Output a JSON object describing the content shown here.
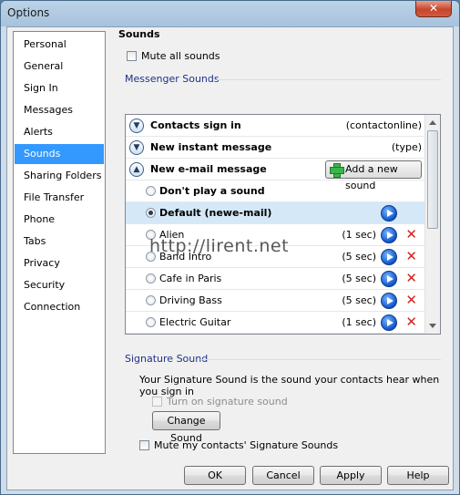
{
  "window": {
    "title": "Options",
    "close_glyph": "✕"
  },
  "nav": {
    "items": [
      "Personal",
      "General",
      "Sign In",
      "Messages",
      "Alerts",
      "Sounds",
      "Sharing Folders",
      "File Transfer",
      "Phone",
      "Tabs",
      "Privacy",
      "Security",
      "Connection"
    ],
    "selected": "Sounds"
  },
  "sounds": {
    "title": "Sounds",
    "mute_all_label": "Mute all sounds",
    "mute_all_checked": false,
    "messenger_sounds_label": "Messenger Sounds",
    "events": [
      {
        "label": "Contacts sign in",
        "value": "(contactonline)",
        "expanded": false
      },
      {
        "label": "New instant message",
        "value": "(type)",
        "expanded": false
      },
      {
        "label": "New e-mail message",
        "expanded": true,
        "action_label": "Add a new sound"
      }
    ],
    "options": [
      {
        "name": "Don't play a sound",
        "duration": "",
        "selected": false
      },
      {
        "name": "Default (newe-mail)",
        "duration": "",
        "selected": true
      },
      {
        "name": "Alien",
        "duration": "(1 sec)",
        "selected": false
      },
      {
        "name": "Band Intro",
        "duration": "(5 sec)",
        "selected": false
      },
      {
        "name": "Cafe in Paris",
        "duration": "(5 sec)",
        "selected": false
      },
      {
        "name": "Driving Bass",
        "duration": "(5 sec)",
        "selected": false
      },
      {
        "name": "Electric Guitar",
        "duration": "(1 sec)",
        "selected": false
      }
    ]
  },
  "signature": {
    "label": "Signature Sound",
    "description": "Your Signature Sound is the sound your contacts hear when you sign in",
    "turn_on_label": "Turn on signature sound",
    "turn_on_enabled": false,
    "change_button": "Change Sound",
    "mute_contacts_label": "Mute my contacts' Signature Sounds",
    "mute_contacts_checked": false
  },
  "footer": {
    "ok": "OK",
    "cancel": "Cancel",
    "apply": "Apply",
    "help": "Help"
  },
  "watermark": "http://lirent.net",
  "icons": {
    "expand": "chevron-down-icon",
    "collapse": "chevron-up-icon",
    "play": "play-icon",
    "delete": "delete-x-icon",
    "add": "plus-icon"
  },
  "colors": {
    "selection": "#3399ff",
    "play": "#1153c9",
    "delete": "#d2231f",
    "add": "#3bb54a"
  }
}
